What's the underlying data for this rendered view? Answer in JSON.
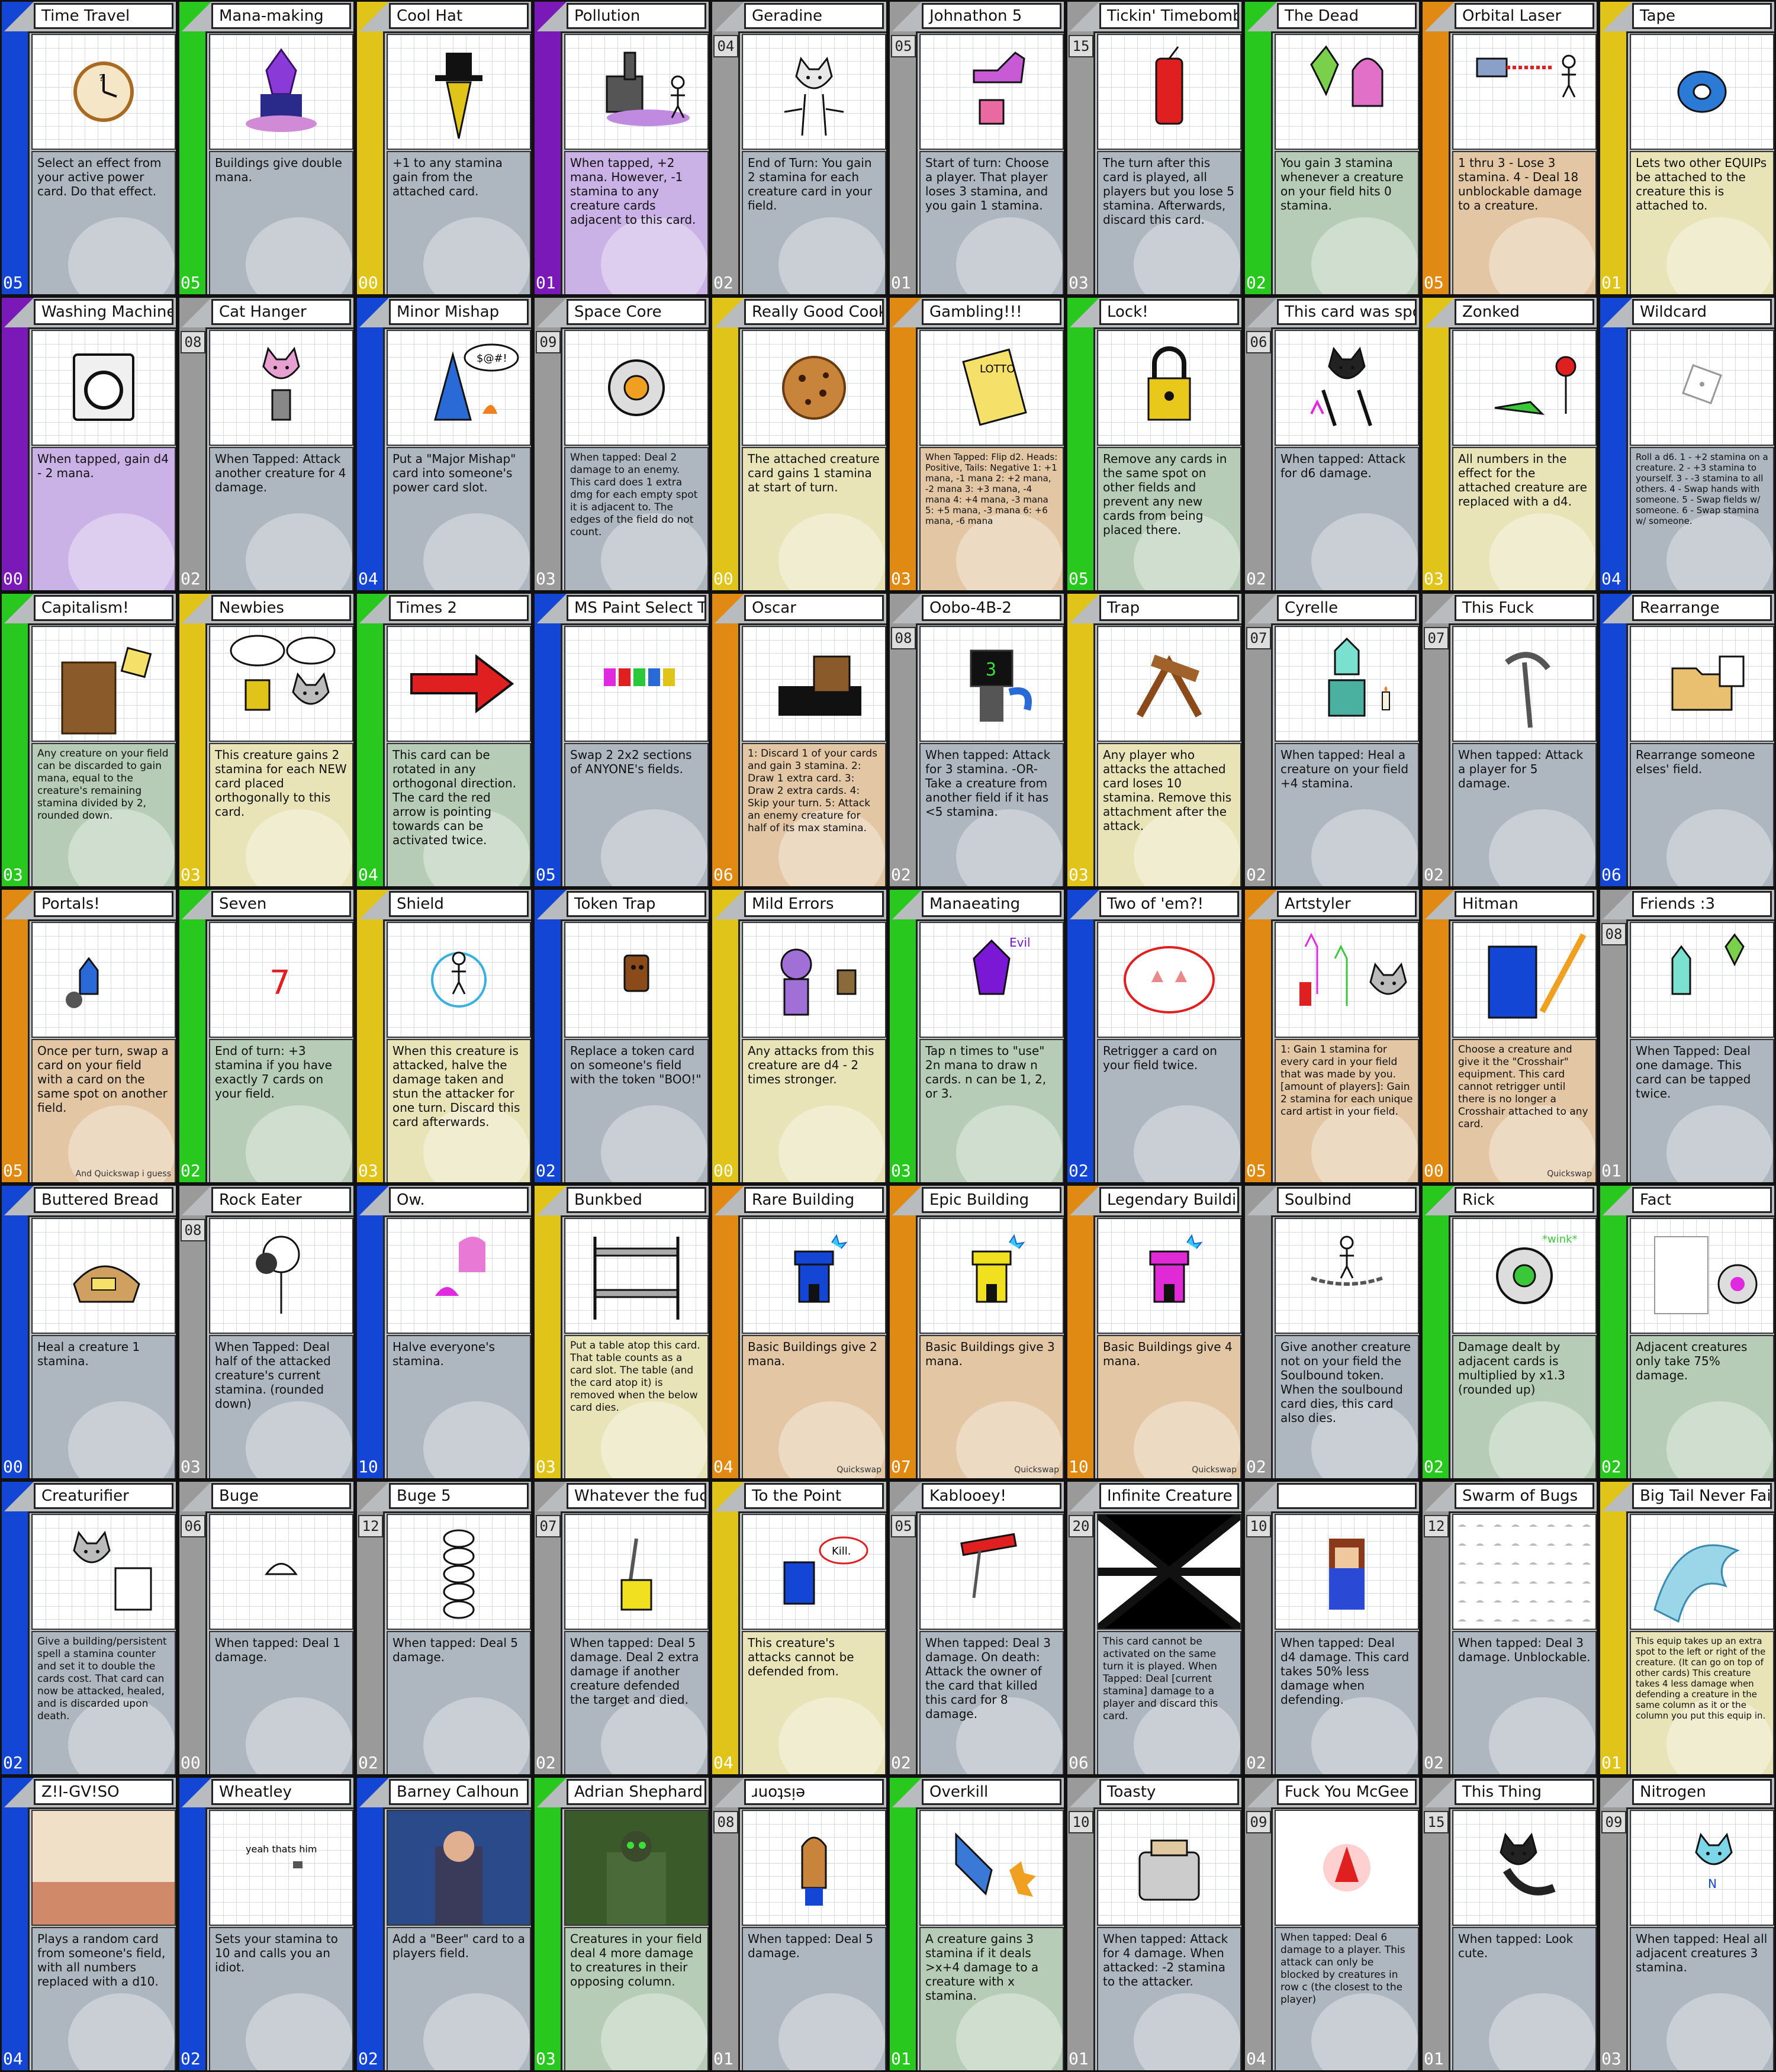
{
  "cards": [
    {
      "name": "Time Travel",
      "cost": "",
      "power": "05",
      "color": "#1446d6",
      "box": "#aeb6bf",
      "effect": "Select an effect from your active power card. Do that effect.",
      "icon": "clock-icon",
      "art": "clock"
    },
    {
      "name": "Mana-making",
      "cost": "",
      "power": "05",
      "color": "#28c81e",
      "box": "#aeb6bf",
      "effect": "Buildings give double mana.",
      "icon": "castle-icon",
      "art": "castle"
    },
    {
      "name": "Cool Hat",
      "cost": "",
      "power": "00",
      "color": "#e0c41a",
      "box": "#aeb6bf",
      "effect": "+1 to any stamina gain from the attached card.",
      "icon": "top-hat-icon",
      "art": "hat"
    },
    {
      "name": "Pollution",
      "cost": "",
      "power": "01",
      "color": "#7a18b8",
      "box": "#cbb2e6",
      "effect": "When tapped, +2 mana. However, -1 stamina to any creature cards adjacent to this card.",
      "icon": "factory-icon",
      "art": "factory"
    },
    {
      "name": "Geradine",
      "cost": "04",
      "power": "02",
      "color": "#9a9a9a",
      "box": "#aeb6bf",
      "effect": "End of Turn: You gain 2 stamina for each creature card in your field.",
      "icon": "cat-icon",
      "art": "cat"
    },
    {
      "name": "Johnathon 5",
      "cost": "05",
      "power": "01",
      "color": "#9a9a9a",
      "box": "#aeb6bf",
      "effect": "Start of turn: Choose a player. That player loses 3 stamina, and you gain 1 stamina.",
      "icon": "thumbs-up-icon",
      "art": "thumb"
    },
    {
      "name": "Tickin' Timebomb",
      "cost": "15",
      "power": "03",
      "color": "#9a9a9a",
      "box": "#aeb6bf",
      "effect": "The turn after this card is played, all players but you lose 5 stamina. Afterwards, discard this card.",
      "icon": "bomb-icon",
      "art": "bomb"
    },
    {
      "name": "The Dead",
      "cost": "",
      "power": "02",
      "color": "#28c81e",
      "box": "#b6ccb6",
      "effect": "You gain 3 stamina whenever a creature on your field hits 0 stamina.",
      "icon": "ghost-icon",
      "art": "ghosts"
    },
    {
      "name": "Orbital Laser",
      "cost": "",
      "power": "05",
      "color": "#e08a14",
      "box": "#e3c7a4",
      "effect": "1 thru 3 - Lose 3 stamina. 4 - Deal 18 unblockable damage to a creature.",
      "icon": "laser-icon",
      "art": "laser"
    },
    {
      "name": "Tape",
      "cost": "",
      "power": "01",
      "color": "#e0c41a",
      "box": "#e8e4b8",
      "effect": "Lets two other EQUIPs be attached to the creature this is attached to.",
      "icon": "tape-icon",
      "art": "tape"
    },
    {
      "name": "Washing Machine",
      "cost": "",
      "power": "00",
      "color": "#7a18b8",
      "box": "#cbb2e6",
      "effect": "When tapped, gain d4 - 2 mana.",
      "icon": "washing-machine-icon",
      "art": "washer"
    },
    {
      "name": "Cat Hanger",
      "cost": "08",
      "power": "02",
      "color": "#9a9a9a",
      "box": "#aeb6bf",
      "effect": "When Tapped: Attack another creature for 4 damage.",
      "icon": "cat-icon",
      "art": "cathang"
    },
    {
      "name": "Minor Mishap",
      "cost": "",
      "power": "04",
      "color": "#1446d6",
      "box": "#aeb6bf",
      "effect": "Put a \"Major Mishap\" card into someone's power card slot.",
      "icon": "wizard-icon",
      "art": "wizard"
    },
    {
      "name": "Space Core",
      "cost": "09",
      "power": "03",
      "color": "#9a9a9a",
      "box": "#aeb6bf",
      "effect": "When tapped: Deal 2 damage to an enemy. This card does 1 extra dmg for each empty spot it is adjacent to. The edges of the field do not count.",
      "icon": "core-icon",
      "art": "core"
    },
    {
      "name": "Really Good Cookie",
      "cost": "",
      "power": "00",
      "color": "#e0c41a",
      "box": "#e8e4b8",
      "effect": "The attached creature card gains 1 stamina at start of turn.",
      "icon": "cookie-icon",
      "art": "cookie"
    },
    {
      "name": "Gambling!!!",
      "cost": "",
      "power": "03",
      "color": "#e08a14",
      "box": "#e3c7a4",
      "effect": "When Tapped: Flip d2. Heads: Positive, Tails: Negative  1: +1 mana, -1 mana  2: +2 mana, -2 mana  3: +3 mana, -4 mana  4: +4 mana, -3 mana  5: +5 mana, -3 mana  6: +6 mana, -6 mana",
      "icon": "lotto-ticket-icon",
      "art": "lotto"
    },
    {
      "name": "Lock!",
      "cost": "",
      "power": "05",
      "color": "#28c81e",
      "box": "#b6ccb6",
      "effect": "Remove any cards in the same spot on other fields and prevent any new cards from being placed there.",
      "icon": "padlock-icon",
      "art": "lock"
    },
    {
      "name": "This card was sponsored by GLUMBOCORP",
      "cost": "06",
      "power": "02",
      "color": "#9a9a9a",
      "box": "#aeb6bf",
      "effect": "When tapped: Attack for d6 damage.",
      "icon": "creature-icon",
      "art": "glumbo"
    },
    {
      "name": "Zonked",
      "cost": "",
      "power": "03",
      "color": "#e0c41a",
      "box": "#e8e4b8",
      "effect": "All numbers in the effect for the attached creature are replaced with a d4.",
      "icon": "zonk-icon",
      "art": "zonk"
    },
    {
      "name": "Wildcard",
      "cost": "",
      "power": "04",
      "color": "#1446d6",
      "box": "#aeb6bf",
      "effect": "Roll a d6. 1 - +2 stamina on a creature. 2 - +3 stamina to yourself. 3 - -3 stamina to all others. 4 - Swap hands with someone. 5 - Swap fields w/ someone. 6 - Swap stamina w/ someone.",
      "icon": "dice-icon",
      "art": "dice"
    },
    {
      "name": "Capitalism!",
      "cost": "",
      "power": "03",
      "color": "#28c81e",
      "box": "#b6ccb6",
      "effect": "Any creature on your field can be discarded to gain mana, equal to the creature's remaining stamina divided by 2, rounded down.",
      "icon": "businessman-icon",
      "art": "biz"
    },
    {
      "name": "Newbies",
      "cost": "",
      "power": "03",
      "color": "#e0c41a",
      "box": "#e8e4b8",
      "effect": "This creature gains 2 stamina for each NEW card placed orthogonally to this card.",
      "icon": "speech-bubble-icon",
      "art": "newbies"
    },
    {
      "name": "Times 2",
      "cost": "",
      "power": "04",
      "color": "#28c81e",
      "box": "#b6ccb6",
      "effect": "This card can be rotated in any orthogonal direction. The card the red arrow is pointing towards can be activated twice.",
      "icon": "arrow-icon",
      "art": "arrow"
    },
    {
      "name": "MS Paint Select Tool",
      "cost": "",
      "power": "05",
      "color": "#1446d6",
      "box": "#aeb6bf",
      "effect": "Swap 2 2x2 sections of ANYONE's fields.",
      "icon": "select-tool-icon",
      "art": "select"
    },
    {
      "name": "Oscar",
      "cost": "",
      "power": "06",
      "color": "#e08a14",
      "box": "#e3c7a4",
      "effect": "1: Discard 1 of your cards and gain 3 stamina. 2: Draw 1 extra card. 3: Draw 2 extra cards. 4: Skip your turn. 5: Attack an enemy creature for half of its max stamina.",
      "icon": "piano-icon",
      "art": "piano"
    },
    {
      "name": "Oobo-4B-2",
      "cost": "08",
      "power": "02",
      "color": "#9a9a9a",
      "box": "#aeb6bf",
      "effect": "When tapped: Attack for 3 stamina. -OR- Take a creature from another field if it has <5 stamina.",
      "icon": "robot-icon",
      "art": "robot"
    },
    {
      "name": "Trap",
      "cost": "",
      "power": "03",
      "color": "#e0c41a",
      "box": "#e8e4b8",
      "effect": "Any player who attacks the attached card loses 10 stamina. Remove this attachment after the attack.",
      "icon": "trap-icon",
      "art": "trap"
    },
    {
      "name": "Cyrelle",
      "cost": "07",
      "power": "02",
      "color": "#9a9a9a",
      "box": "#aeb6bf",
      "effect": "When tapped: Heal a creature on your field +4 stamina.",
      "icon": "candle-icon",
      "art": "cyrelle"
    },
    {
      "name": "This Fuck",
      "cost": "07",
      "power": "02",
      "color": "#9a9a9a",
      "box": "#aeb6bf",
      "effect": "When tapped: Attack a player for 5 damage.",
      "icon": "pickaxe-icon",
      "art": "pick"
    },
    {
      "name": "Rearrange",
      "cost": "",
      "power": "06",
      "color": "#1446d6",
      "box": "#aeb6bf",
      "effect": "Rearrange someone elses' field.",
      "icon": "folder-icon",
      "art": "folder"
    },
    {
      "name": "Portals!",
      "cost": "",
      "power": "05",
      "color": "#e08a14",
      "box": "#e3c7a4",
      "effect": "Once per turn, swap a card on your field with a card on the same spot on another field.",
      "icon": "portal-icon",
      "art": "portal",
      "credit": "And Quickswap i guess"
    },
    {
      "name": "Seven",
      "cost": "",
      "power": "02",
      "color": "#28c81e",
      "box": "#b6ccb6",
      "effect": "End of turn: +3 stamina if you have exactly 7 cards on your field.",
      "icon": "seven-icon",
      "art": "seven"
    },
    {
      "name": "Shield",
      "cost": "",
      "power": "03",
      "color": "#e0c41a",
      "box": "#e8e4b8",
      "effect": "When this creature is attacked, halve the damage taken and stun the attacker for one turn. Discard this card afterwards.",
      "icon": "shield-icon",
      "art": "shield"
    },
    {
      "name": "Token Trap",
      "cost": "",
      "power": "02",
      "color": "#1446d6",
      "box": "#aeb6bf",
      "effect": "Replace a token card on someone's field with the token \"BOO!\"",
      "icon": "token-icon",
      "art": "token"
    },
    {
      "name": "Mild Errors",
      "cost": "",
      "power": "00",
      "color": "#e0c41a",
      "box": "#e8e4b8",
      "effect": "Any attacks from this creature are d4 - 2 times stronger.",
      "icon": "error-icon",
      "art": "errors"
    },
    {
      "name": "Manaeating",
      "cost": "",
      "power": "03",
      "color": "#28c81e",
      "box": "#b6ccb6",
      "effect": "Tap n times to \"use\" 2n mana to draw n cards. n can be 1, 2, or 3.",
      "icon": "evil-icon",
      "art": "evil"
    },
    {
      "name": "Two of 'em?!",
      "cost": "",
      "power": "02",
      "color": "#1446d6",
      "box": "#aeb6bf",
      "effect": "Retrigger a card on your field twice.",
      "icon": "pig-icon",
      "art": "pig"
    },
    {
      "name": "Artstyler",
      "cost": "",
      "power": "05",
      "color": "#e08a14",
      "box": "#e3c7a4",
      "effect": "1: Gain 1 stamina for every card in your field that was made by you. [amount of players]: Gain 2 stamina for each unique card artist in your field.",
      "icon": "artist-icon",
      "art": "artist"
    },
    {
      "name": "Hitman",
      "cost": "",
      "power": "00",
      "color": "#e08a14",
      "box": "#e3c7a4",
      "effect": "Choose a creature and give it the \"Crosshair\" equipment. This card cannot retrigger until there is no longer a Crosshair attached to any card.",
      "icon": "crosshair-icon",
      "art": "hitman",
      "credit": "Quickswap"
    },
    {
      "name": "Friends :3",
      "cost": "08",
      "power": "01",
      "color": "#9a9a9a",
      "box": "#aeb6bf",
      "effect": "When Tapped: Deal one damage. This card can be tapped twice.",
      "icon": "friends-icon",
      "art": "friends"
    },
    {
      "name": "Buttered Bread",
      "cost": "",
      "power": "00",
      "color": "#1446d6",
      "box": "#aeb6bf",
      "effect": "Heal a creature 1 stamina.",
      "icon": "bread-icon",
      "art": "bread"
    },
    {
      "name": "Rock Eater",
      "cost": "08",
      "power": "03",
      "color": "#9a9a9a",
      "box": "#aeb6bf",
      "effect": "When Tapped: Deal half of the attacked creature's current stamina. (rounded down)",
      "icon": "rock-icon",
      "art": "rock"
    },
    {
      "name": "Ow.",
      "cost": "",
      "power": "10",
      "color": "#1446d6",
      "box": "#aeb6bf",
      "effect": "Halve everyone's stamina.",
      "icon": "ghost-icon",
      "art": "ow"
    },
    {
      "name": "Bunkbed",
      "cost": "",
      "power": "03",
      "color": "#e0c41a",
      "box": "#e8e4b8",
      "effect": "Put a table atop this card. That table counts as a card slot. The table (and the card atop it) is removed when the below card dies.",
      "icon": "bunkbed-icon",
      "art": "bunk"
    },
    {
      "name": "Rare Building",
      "cost": "",
      "power": "04",
      "color": "#e08a14",
      "box": "#e3c7a4",
      "effect": "Basic Buildings give 2 mana.",
      "icon": "tower-icon",
      "art": "tower-blue",
      "credit": "Quickswap"
    },
    {
      "name": "Epic Building",
      "cost": "",
      "power": "07",
      "color": "#e08a14",
      "box": "#e3c7a4",
      "effect": "Basic Buildings give 3 mana.",
      "icon": "tower-icon",
      "art": "tower-yellow",
      "credit": "Quickswap"
    },
    {
      "name": "Legendary Building",
      "cost": "",
      "power": "10",
      "color": "#e08a14",
      "box": "#e3c7a4",
      "effect": "Basic Buildings give 4 mana.",
      "icon": "tower-icon",
      "art": "tower-pink",
      "credit": "Quickswap"
    },
    {
      "name": "Soulbind",
      "cost": "",
      "power": "02",
      "color": "#9a9a9a",
      "box": "#aeb6bf",
      "effect": "Give another creature not on your field the Soulbound token. When the soulbound card dies, this card also dies.",
      "icon": "chain-icon",
      "art": "soul"
    },
    {
      "name": "Rick",
      "cost": "",
      "power": "02",
      "color": "#28c81e",
      "box": "#b6ccb6",
      "effect": "Damage dealt by adjacent cards is multiplied by x1.3 (rounded up)",
      "icon": "core-icon",
      "art": "rick"
    },
    {
      "name": "Fact",
      "cost": "",
      "power": "02",
      "color": "#28c81e",
      "box": "#b6ccb6",
      "effect": "Adjacent creatures only take 75% damage.",
      "icon": "core-icon",
      "art": "fact"
    },
    {
      "name": "Creaturifier",
      "cost": "",
      "power": "02",
      "color": "#1446d6",
      "box": "#aeb6bf",
      "effect": "Give a building/persistent spell a stamina counter and set it to double the cards cost. That card can now be attacked, healed, and is discarded upon death.",
      "icon": "cat-icon",
      "art": "creat"
    },
    {
      "name": "Buge",
      "cost": "06",
      "power": "00",
      "color": "#9a9a9a",
      "box": "#aeb6bf",
      "effect": "When tapped: Deal 1 damage.",
      "icon": "bug-icon",
      "art": "buge"
    },
    {
      "name": "Buge 5",
      "cost": "12",
      "power": "02",
      "color": "#9a9a9a",
      "box": "#aeb6bf",
      "effect": "When tapped: Deal 5 damage.",
      "icon": "bug-icon",
      "art": "buge5"
    },
    {
      "name": "Whatever the fuck this thing is",
      "cost": "07",
      "power": "02",
      "color": "#9a9a9a",
      "box": "#aeb6bf",
      "effect": "When tapped: Deal 5 damage. Deal 2 extra damage if another creature defended the target and died.",
      "icon": "lamp-icon",
      "art": "lamp"
    },
    {
      "name": "To the Point",
      "cost": "",
      "power": "04",
      "color": "#e0c41a",
      "box": "#e8e4b8",
      "effect": "This creature's attacks cannot be defended from.",
      "icon": "kill-icon",
      "art": "kill"
    },
    {
      "name": "Kablooey!",
      "cost": "05",
      "power": "02",
      "color": "#9a9a9a",
      "box": "#aeb6bf",
      "effect": "When tapped: Deal 3 damage. On death: Attack the owner of the card that killed this card for 8 damage.",
      "icon": "rocket-icon",
      "art": "rocket"
    },
    {
      "name": "Infinite Creature Vortex",
      "cost": "20",
      "power": "06",
      "color": "#9a9a9a",
      "box": "#aeb6bf",
      "effect": "This card cannot be activated on the same turn it is played. When Tapped: Deal [current stamina] damage to a player and discard this card.",
      "icon": "vortex-icon",
      "art": "vortex"
    },
    {
      "name": "",
      "cost": "10",
      "power": "02",
      "color": "#9a9a9a",
      "box": "#aeb6bf",
      "effect": "When tapped: Deal d4 damage. This card takes 50% less damage when defending.",
      "icon": "pixel-girl-icon",
      "art": "pixgirl"
    },
    {
      "name": "Swarm of Bugs",
      "cost": "12",
      "power": "02",
      "color": "#9a9a9a",
      "box": "#aeb6bf",
      "effect": "When tapped: Deal 3 damage. Unblockable.",
      "icon": "bug-swarm-icon",
      "art": "swarm"
    },
    {
      "name": "Big Tail Never Fail",
      "cost": "",
      "power": "01",
      "color": "#e0c41a",
      "box": "#e8e4b8",
      "effect": "This equip takes up an extra spot to the left or right of the creature. (It can go on top of other cards) This creature takes 4 less damage when defending a creature in the same column as it or the column you put this equip in.",
      "icon": "tail-icon",
      "art": "tail"
    },
    {
      "name": "Z!I-GV!SO",
      "cost": "",
      "power": "04",
      "color": "#1446d6",
      "box": "#aeb6bf",
      "effect": "Plays a random card from someone's field, with all numbers replaced with a d10.",
      "icon": "glitch-icon",
      "art": "glitch"
    },
    {
      "name": "Wheatley",
      "cost": "",
      "power": "02",
      "color": "#1446d6",
      "box": "#aeb6bf",
      "effect": "Sets your stamina to 10 and calls you an idiot.",
      "icon": "core-icon",
      "art": "wheatley"
    },
    {
      "name": "Barney Calhoun",
      "cost": "",
      "power": "02",
      "color": "#1446d6",
      "box": "#aeb6bf",
      "effect": "Add a \"Beer\" card to a players field.",
      "icon": "guard-icon",
      "art": "barney"
    },
    {
      "name": "Adrian Shephard",
      "cost": "",
      "power": "03",
      "color": "#28c81e",
      "box": "#b6ccb6",
      "effect": "Creatures in your field deal 4 more damage to creatures in their opposing column.",
      "icon": "soldier-icon",
      "art": "adrian"
    },
    {
      "name": "ɹuoʇsᴉǝ",
      "cost": "08",
      "power": "01",
      "color": "#9a9a9a",
      "box": "#aeb6bf",
      "effect": "When tapped: Deal 5 damage.",
      "icon": "horse-icon",
      "art": "horse"
    },
    {
      "name": "Overkill",
      "cost": "",
      "power": "01",
      "color": "#28c81e",
      "box": "#b6ccb6",
      "effect": "A creature gains 3 stamina if it deals >x+4 damage to a creature with x stamina.",
      "icon": "explosion-icon",
      "art": "overkill"
    },
    {
      "name": "Toasty",
      "cost": "10",
      "power": "01",
      "color": "#9a9a9a",
      "box": "#aeb6bf",
      "effect": "When tapped: Attack for 4 damage. When attacked: -2 stamina to the attacker.",
      "icon": "toaster-icon",
      "art": "toaster"
    },
    {
      "name": "Fuck You McGee",
      "cost": "09",
      "power": "04",
      "color": "#9a9a9a",
      "box": "#aeb6bf",
      "effect": "When tapped: Deal 6 damage to a player. This attack can only be blocked by creatures in row c (the closest to the player)",
      "icon": "creature-icon",
      "art": "mcgee"
    },
    {
      "name": "This Thing",
      "cost": "15",
      "power": "01",
      "color": "#9a9a9a",
      "box": "#aeb6bf",
      "effect": "When tapped: Look cute.",
      "icon": "cat-icon",
      "art": "thing"
    },
    {
      "name": "Nitrogen",
      "cost": "09",
      "power": "03",
      "color": "#9a9a9a",
      "box": "#aeb6bf",
      "effect": "When tapped: Heal all adjacent creatures 3 stamina.",
      "icon": "cat-icon",
      "art": "nitrogen"
    }
  ]
}
